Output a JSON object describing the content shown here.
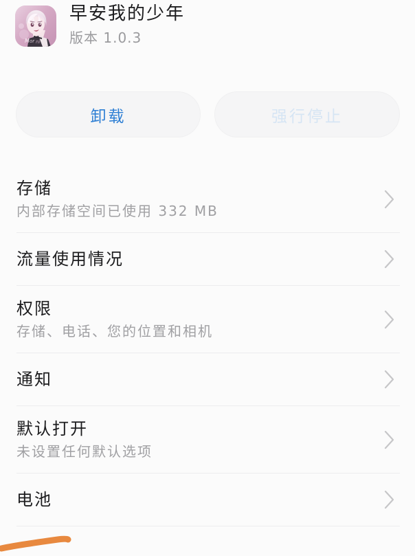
{
  "app": {
    "name": "早安我的少年",
    "version_label": "版本 1.0.3",
    "icon_name": "app-icon-anime-portrait"
  },
  "actions": {
    "uninstall_label": "卸载",
    "force_stop_label": "强行停止",
    "uninstall_color": "#2e7fd4",
    "force_stop_color": "#d6e5f4",
    "button_bg": "#f5f5f6"
  },
  "list": {
    "items": [
      {
        "name": "storage",
        "title": "存储",
        "subtitle": "内部存储空间已使用 332 MB",
        "chevron": "chevron-right-icon"
      },
      {
        "name": "data-usage",
        "title": "流量使用情况",
        "subtitle": "",
        "chevron": "chevron-right-icon"
      },
      {
        "name": "permissions",
        "title": "权限",
        "subtitle": "存储、电话、您的位置和相机",
        "chevron": "chevron-right-icon"
      },
      {
        "name": "notifications",
        "title": "通知",
        "subtitle": "",
        "chevron": "chevron-right-icon"
      },
      {
        "name": "open-by-default",
        "title": "默认打开",
        "subtitle": "未设置任何默认选项",
        "chevron": "chevron-right-icon"
      },
      {
        "name": "battery",
        "title": "电池",
        "subtitle": "",
        "chevron": "chevron-right-icon"
      }
    ]
  },
  "annotation": {
    "name": "orange-underline-stroke",
    "color": "#e8893f"
  },
  "colors": {
    "background": "#fbfbfb",
    "title_text": "#1c1c1e",
    "secondary_text": "#a0a0a3",
    "divider": "#ececee",
    "chevron": "#c6c6c8"
  }
}
